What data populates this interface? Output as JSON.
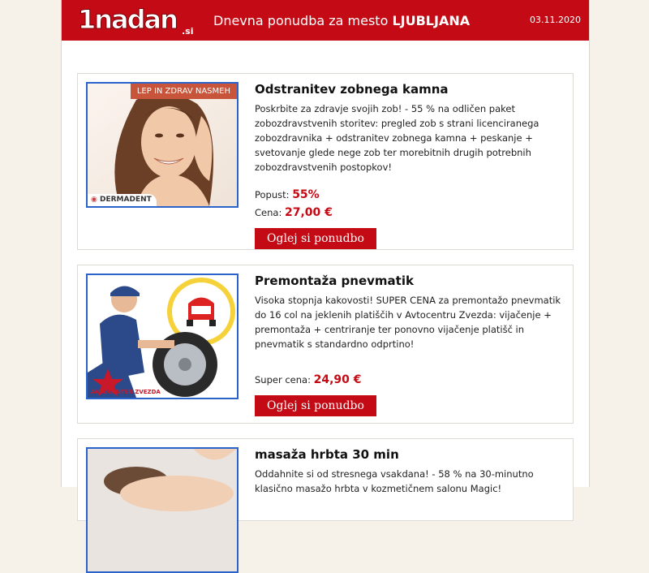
{
  "header": {
    "logo_text": "1nadan",
    "logo_suffix": ".si",
    "title_prefix": "Dnevna ponudba za mesto",
    "city": "LJUBLJANA",
    "date": "03.11.2020"
  },
  "colors": {
    "brand_red": "#c40a14",
    "image_border": "#2a63c9",
    "page_bg": "#f6f2ea"
  },
  "offers": [
    {
      "title": "Odstranitev zobnega kamna",
      "description": "Poskrbite za zdravje svojih zob! - 55 % na odličen paket zobozdravstvenih storitev: pregled zob s strani licenciranega zobozdravnika + odstranitev zobnega kamna + peskanje + svetovanje glede nege zob ter morebitnih drugih potrebnih zobozdravstvenih postopkov!",
      "discount_label": "Popust:",
      "discount_value": "55%",
      "price_label": "Cena:",
      "price_value": "27,00 €",
      "button_label": "Oglej si ponudbo",
      "image_tag": "LEP IN ZDRAV NASMEH",
      "image_brand": "DERMADENT"
    },
    {
      "title": "Premontaža pnevmatik",
      "description": "Visoka stopnja kakovosti! SUPER CENA za premontažo pnevmatik do 16 col na jeklenih platiščih v Avtocentru Zvezda: vijačenje + premontaža + centriranje ter ponovno vijačenje platišč in pnevmatik s standardno odprtino!",
      "price_label": "Super cena:",
      "price_value": "24,90 €",
      "button_label": "Oglej si ponudbo",
      "image_brand": "AVTOCENTER ZVEZDA"
    },
    {
      "title": "masaža hrbta 30 min",
      "description": "Oddahnite si od stresnega vsakdana! - 58 % na 30-minutno klasično masažo hrbta v kozmetičnem salonu Magic!"
    }
  ]
}
